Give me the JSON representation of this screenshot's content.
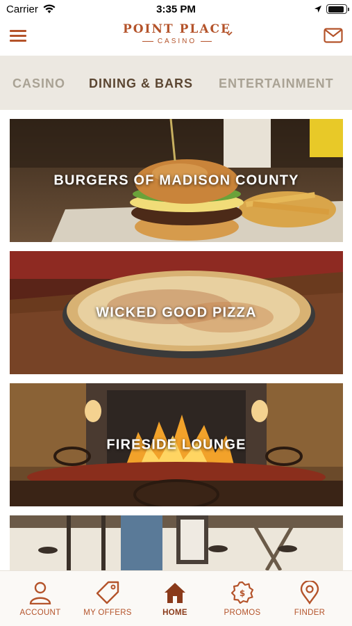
{
  "status_bar": {
    "carrier": "Carrier",
    "time": "3:35 PM"
  },
  "header": {
    "logo_main": "POINT PLACE",
    "logo_sub": "CASINO",
    "accent_color": "#b4532a"
  },
  "category_tabs": [
    {
      "label": "CASINO",
      "active": false
    },
    {
      "label": "DINING & BARS",
      "active": true
    },
    {
      "label": "ENTERTAINMENT",
      "active": false
    }
  ],
  "venues": [
    {
      "title": "BURGERS OF MADISON COUNTY"
    },
    {
      "title": "WICKED GOOD PIZZA"
    },
    {
      "title": "FIRESIDE LOUNGE"
    },
    {
      "title": ""
    }
  ],
  "tab_bar": [
    {
      "label": "ACCOUNT",
      "icon": "person-icon",
      "active": false
    },
    {
      "label": "MY OFFERS",
      "icon": "tag-icon",
      "active": false
    },
    {
      "label": "HOME",
      "icon": "home-icon",
      "active": true
    },
    {
      "label": "PROMOS",
      "icon": "badge-icon",
      "active": false
    },
    {
      "label": "FINDER",
      "icon": "map-pin-icon",
      "active": false
    }
  ]
}
